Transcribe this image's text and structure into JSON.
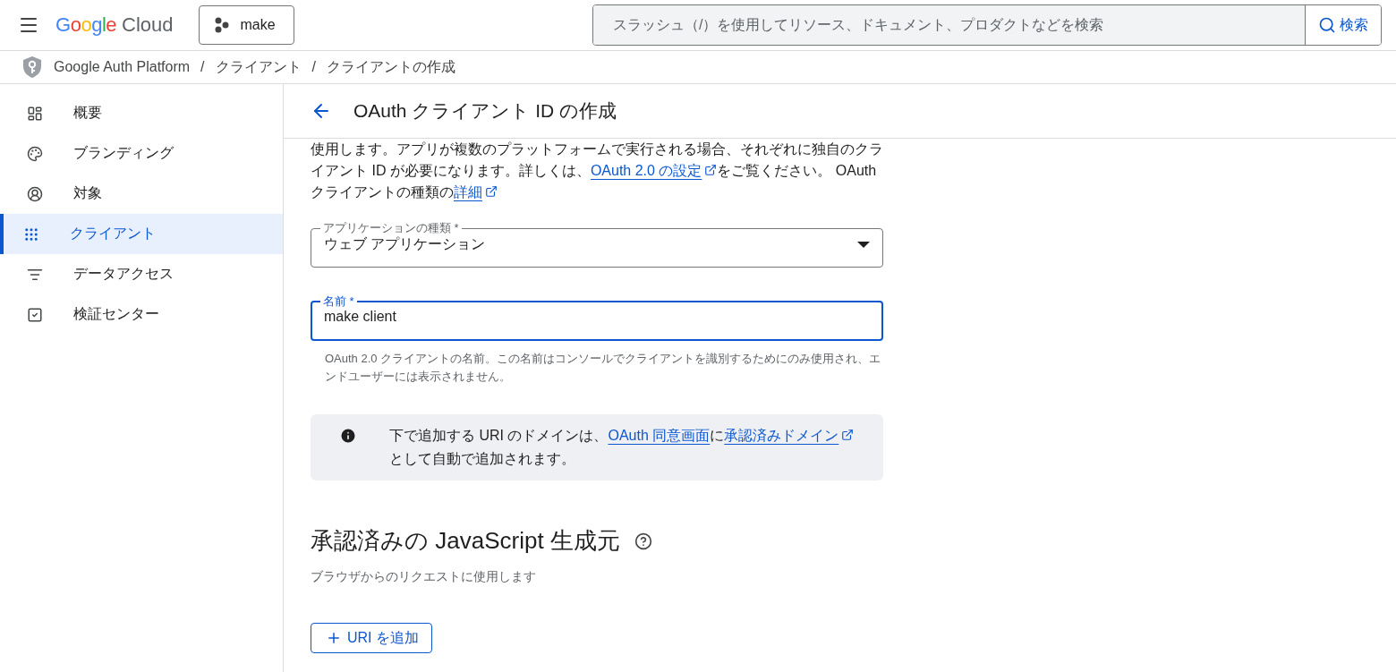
{
  "header": {
    "logo": {
      "brand": "Google",
      "product": "Cloud"
    },
    "project": "make",
    "search": {
      "placeholder": "スラッシュ（/）を使用してリソース、ドキュメント、プロダクトなどを検索",
      "button": "検索"
    }
  },
  "breadcrumb": {
    "separator": "/",
    "items": [
      "Google Auth Platform",
      "クライアント",
      "クライアントの作成"
    ]
  },
  "sidebar": {
    "items": [
      {
        "label": "概要",
        "selected": false
      },
      {
        "label": "ブランディング",
        "selected": false
      },
      {
        "label": "対象",
        "selected": false
      },
      {
        "label": "クライアント",
        "selected": true
      },
      {
        "label": "データアクセス",
        "selected": false
      },
      {
        "label": "検証センター",
        "selected": false
      }
    ]
  },
  "page": {
    "title": "OAuth クライアント ID の作成",
    "intro": [
      {
        "kind": "text",
        "text": "使用します。アプリが複数のプラットフォームで実行される場合、それぞれに独自のクライアント ID が必要になります。詳しくは、"
      },
      {
        "kind": "link",
        "text": "OAuth 2.0 の設定",
        "external": true
      },
      {
        "kind": "text",
        "text": "をご覧ください。 OAuth クライアントの種類の"
      },
      {
        "kind": "link",
        "text": "詳細",
        "external": true
      }
    ],
    "app_type": {
      "label": "アプリケーションの種類 *",
      "value": "ウェブ アプリケーション"
    },
    "name_field": {
      "label": "名前 *",
      "value": "make client",
      "focused": true,
      "helper": "OAuth 2.0 クライアントの名前。この名前はコンソールでクライアントを識別するためにのみ使用され、エンドユーザーには表示されません。"
    },
    "notice": [
      {
        "kind": "text",
        "text": "下で追加する URI のドメインは、"
      },
      {
        "kind": "link",
        "text": "OAuth 同意画面",
        "external": false
      },
      {
        "kind": "text",
        "text": "に"
      },
      {
        "kind": "link",
        "text": "承認済みドメイン",
        "external": true
      },
      {
        "kind": "text",
        "text": "として自動で追加されます。"
      }
    ],
    "section": {
      "title": "承認済みの JavaScript 生成元",
      "subtitle": "ブラウザからのリクエストに使用します",
      "add_button": "URI を追加"
    }
  }
}
